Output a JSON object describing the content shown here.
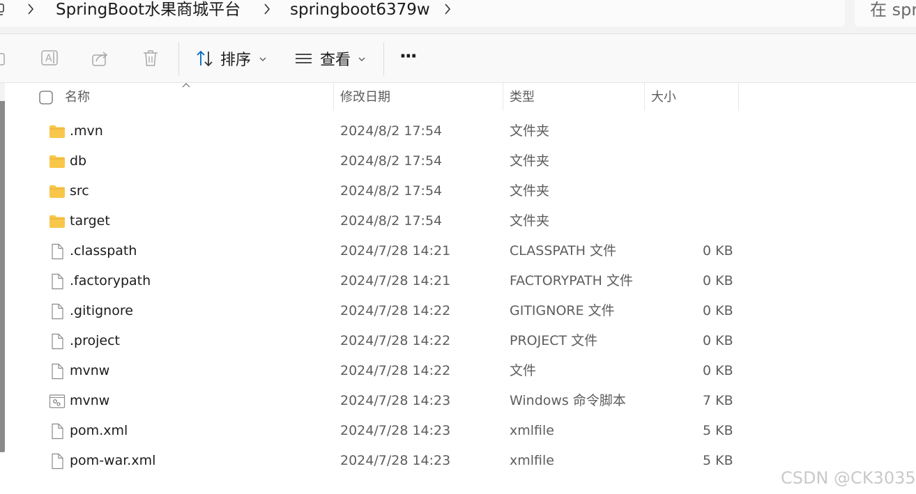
{
  "breadcrumb": {
    "items": [
      "SpringBoot水果商城平台",
      "springboot6379w"
    ]
  },
  "search": {
    "placeholder": "在 spr"
  },
  "toolbar": {
    "sort_label": "排序",
    "view_label": "查看",
    "more_label": "···"
  },
  "columns": {
    "name": "名称",
    "date": "修改日期",
    "type": "类型",
    "size": "大小"
  },
  "files": [
    {
      "name": ".mvn",
      "date": "2024/8/2 17:54",
      "type": "文件夹",
      "size": "",
      "icon": "folder-icon"
    },
    {
      "name": "db",
      "date": "2024/8/2 17:54",
      "type": "文件夹",
      "size": "",
      "icon": "folder-icon"
    },
    {
      "name": "src",
      "date": "2024/8/2 17:54",
      "type": "文件夹",
      "size": "",
      "icon": "folder-icon"
    },
    {
      "name": "target",
      "date": "2024/8/2 17:54",
      "type": "文件夹",
      "size": "",
      "icon": "folder-icon"
    },
    {
      "name": ".classpath",
      "date": "2024/7/28 14:21",
      "type": "CLASSPATH 文件",
      "size": "0 KB",
      "icon": "file-icon"
    },
    {
      "name": ".factorypath",
      "date": "2024/7/28 14:21",
      "type": "FACTORYPATH 文件",
      "size": "0 KB",
      "icon": "file-icon"
    },
    {
      "name": ".gitignore",
      "date": "2024/7/28 14:22",
      "type": "GITIGNORE 文件",
      "size": "0 KB",
      "icon": "file-icon"
    },
    {
      "name": ".project",
      "date": "2024/7/28 14:22",
      "type": "PROJECT 文件",
      "size": "0 KB",
      "icon": "file-icon"
    },
    {
      "name": "mvnw",
      "date": "2024/7/28 14:22",
      "type": "文件",
      "size": "0 KB",
      "icon": "file-icon"
    },
    {
      "name": "mvnw",
      "date": "2024/7/28 14:23",
      "type": "Windows 命令脚本",
      "size": "7 KB",
      "icon": "script-icon"
    },
    {
      "name": "pom.xml",
      "date": "2024/7/28 14:23",
      "type": "xmlfile",
      "size": "5 KB",
      "icon": "file-icon"
    },
    {
      "name": "pom-war.xml",
      "date": "2024/7/28 14:23",
      "type": "xmlfile",
      "size": "5 KB",
      "icon": "file-icon"
    }
  ],
  "watermark": "CSDN @CK3035",
  "colors": {
    "accent": "#0067c0",
    "folder": "#f8c74a",
    "folder_tab": "#e8a93a"
  }
}
